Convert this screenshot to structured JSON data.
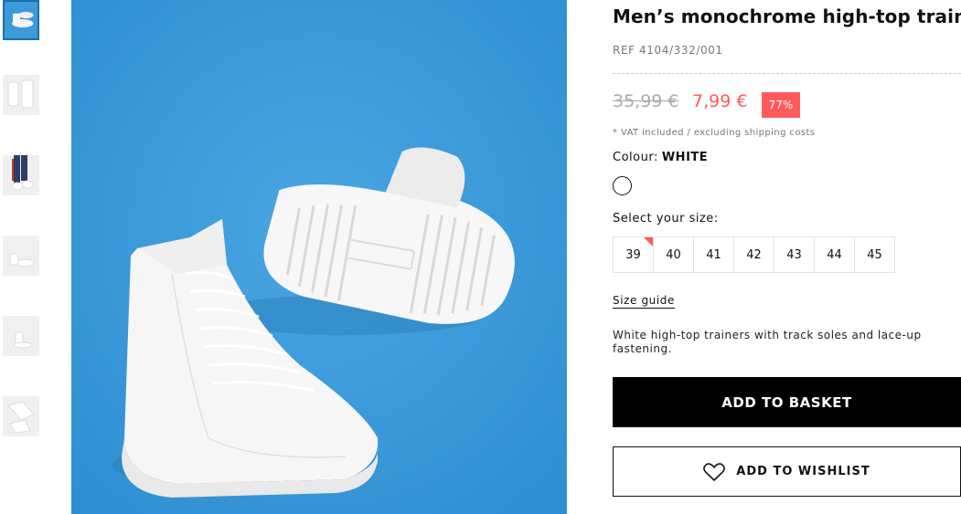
{
  "product": {
    "title": "Men’s monochrome high-top trainers",
    "ref": "REF 4104/332/001"
  },
  "price": {
    "old": "35,99 €",
    "new": "7,99 €",
    "discount": "77%",
    "vat_note": "* VAT included / excluding shipping costs"
  },
  "colour": {
    "label": "Colour:",
    "value": "WHITE"
  },
  "sizes": {
    "label": "Select your size:",
    "options": [
      "39",
      "40",
      "41",
      "42",
      "43",
      "44",
      "45"
    ]
  },
  "size_guide": "Size guide",
  "description": "White high-top trainers with track soles and lace-up fastening.",
  "actions": {
    "add_to_basket": "ADD TO BASKET",
    "add_to_wishlist": "ADD TO WISHLIST"
  },
  "colors": {
    "accent": "#ff5a5a",
    "image_bg": "#3b9ad9"
  }
}
